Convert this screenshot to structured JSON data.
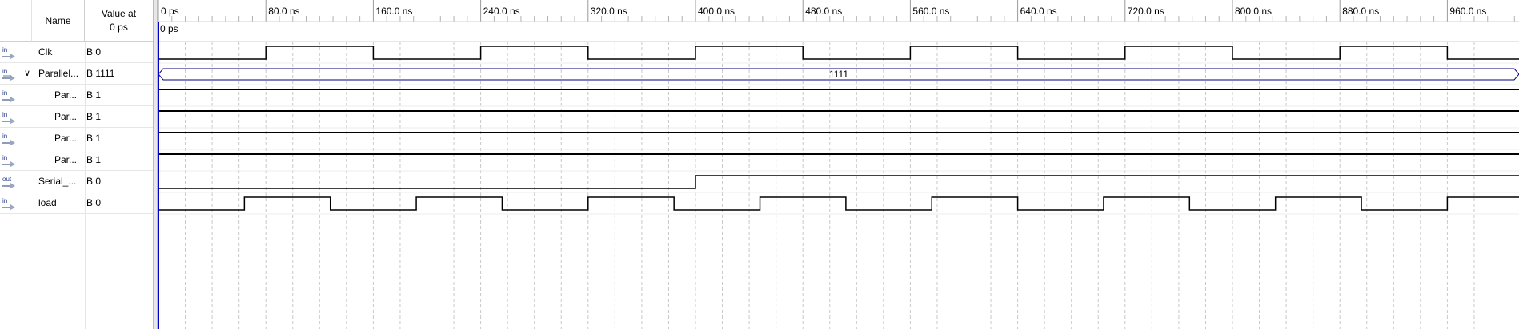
{
  "header": {
    "name_label": "Name",
    "value_label_line1": "Value at",
    "value_label_line2": "0 ps"
  },
  "signals": [
    {
      "dir": "in",
      "name": "Clk",
      "value": "B 0",
      "indent": 0
    },
    {
      "dir": "in",
      "name": "Parallel...",
      "value": "B 1111",
      "indent": 0,
      "expanded": true,
      "expander": "∨"
    },
    {
      "dir": "in",
      "name": "Par...",
      "value": "B 1",
      "indent": 1
    },
    {
      "dir": "in",
      "name": "Par...",
      "value": "B 1",
      "indent": 1
    },
    {
      "dir": "in",
      "name": "Par...",
      "value": "B 1",
      "indent": 1
    },
    {
      "dir": "in",
      "name": "Par...",
      "value": "B 1",
      "indent": 1
    },
    {
      "dir": "out",
      "name": "Serial_...",
      "value": "B 0",
      "indent": 0
    },
    {
      "dir": "in",
      "name": "load",
      "value": "B 0",
      "indent": 0
    }
  ],
  "timeline": {
    "ticks": [
      "0 ps",
      "80.0 ns",
      "160.0 ns",
      "240.0 ns",
      "320.0 ns",
      "400.0 ns",
      "480.0 ns",
      "560.0 ns",
      "640.0 ns",
      "720.0 ns",
      "800.0 ns",
      "880.0 ns",
      "960.0 ns"
    ],
    "cursor_label": "0 ps",
    "range_ns": [
      0,
      1000
    ]
  },
  "waveforms": {
    "clk": {
      "period_ns": 160,
      "high_start_ns": 80
    },
    "bus_value": "1111",
    "serial_rise_ns": 400,
    "load": {
      "period_ns": 128,
      "first_rise_ns": 64,
      "high_width_ns": 64
    }
  },
  "colors": {
    "cursor": "#0000c8",
    "bus_outline": "#000080",
    "wave": "#000000",
    "grid": "#c8c8c8"
  }
}
